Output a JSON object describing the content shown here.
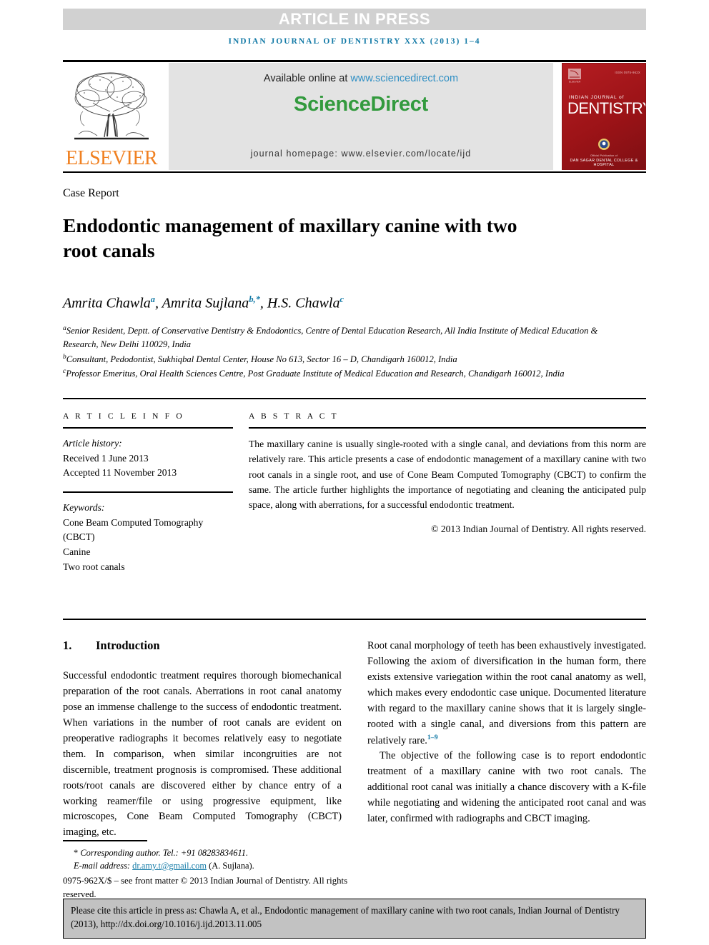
{
  "banner": {
    "article_in_press": "ARTICLE IN PRESS",
    "running_head": "INDIAN JOURNAL OF DENTISTRY XXX (2013) 1–4"
  },
  "masthead": {
    "elsevier_wordmark": "ELSEVIER",
    "available_online_prefix": "Available online at ",
    "sciencedirect_url": "www.sciencedirect.com",
    "sciencedirect_logo": "ScienceDirect",
    "journal_homepage": "journal homepage: www.elsevier.com/locate/ijd",
    "cover": {
      "issn": "ISSN 0975-962X",
      "indian_journal_of": "INDIAN JOURNAL of",
      "dentistry": "DENTISTRY",
      "footline1": "Official Publication of",
      "footline2": "DAN SAGAR DENTAL COLLEGE & HOSPITAL"
    },
    "colors": {
      "banner_gray": "#d1d1d1",
      "running_head_blue": "#1279a6",
      "elsevier_orange": "#f08122",
      "sciencedirect_green": "#339a3e",
      "sd_panel_gray": "#e3e3e3",
      "link_blue": "#2f8fc4",
      "cover_red": "#a4161a"
    }
  },
  "article": {
    "kicker": "Case Report",
    "title": "Endodontic management of maxillary canine with two root canals",
    "authors": [
      {
        "name": "Amrita Chawla",
        "marks": "a"
      },
      {
        "name": "Amrita Sujlana",
        "marks": "b,*"
      },
      {
        "name": "H.S. Chawla",
        "marks": "c"
      }
    ],
    "affiliations": [
      {
        "mark": "a",
        "text": "Senior Resident, Deptt. of Conservative Dentistry & Endodontics, Centre of Dental Education Research, All India Institute of Medical Education & Research, New Delhi 110029, India"
      },
      {
        "mark": "b",
        "text": "Consultant, Pedodontist, Sukhiqbal Dental Center, House No 613, Sector 16 – D, Chandigarh 160012, India"
      },
      {
        "mark": "c",
        "text": "Professor Emeritus, Oral Health Sciences Centre, Post Graduate Institute of Medical Education and Research, Chandigarh 160012, India"
      }
    ]
  },
  "article_info": {
    "heading": "A R T I C L E   I N F O",
    "history_label": "Article history:",
    "received": "Received 1 June 2013",
    "accepted": "Accepted 11 November 2013",
    "keywords_label": "Keywords:",
    "keywords": [
      "Cone Beam Computed Tomography",
      "(CBCT)",
      "Canine",
      "Two root canals"
    ]
  },
  "abstract": {
    "heading": "A B S T R A C T",
    "text": "The maxillary canine is usually single-rooted with a single canal, and deviations from this norm are relatively rare. This article presents a case of endodontic management of a maxillary canine with two root canals in a single root, and use of Cone Beam Computed Tomography (CBCT) to confirm the same. The article further highlights the importance of negotiating and cleaning the anticipated pulp space, along with aberrations, for a successful endodontic treatment.",
    "copyright": "© 2013 Indian Journal of Dentistry. All rights reserved."
  },
  "body": {
    "section_number": "1.",
    "section_title": "Introduction",
    "left_paragraph": "Successful endodontic treatment requires thorough biomechanical preparation of the root canals. Aberrations in root canal anatomy pose an immense challenge to the success of endodontic treatment. When variations in the number of root canals are evident on preoperative radiographs it becomes relatively easy to negotiate them. In comparison, when similar incongruities are not discernible, treatment prognosis is compromised. These additional roots/root canals are discovered either by chance entry of a working reamer/file or using progressive equipment, like microscopes, Cone Beam Computed Tomography (CBCT) imaging, etc.",
    "right_paragraph_1": "Root canal morphology of teeth has been exhaustively investigated. Following the axiom of diversification in the human form, there exists extensive variegation within the root canal anatomy as well, which makes every endodontic case unique. Documented literature with regard to the maxillary canine shows that it is largely single-rooted with a single canal, and diversions from this pattern are relatively rare.",
    "right_paragraph_1_ref": "1–9",
    "right_paragraph_2": "The objective of the following case is to report endodontic treatment of a maxillary canine with two root canals. The additional root canal was initially a chance discovery with a K-file while negotiating and widening the anticipated root canal and was later, confirmed with radiographs and CBCT imaging."
  },
  "footnotes": {
    "corresponding_star": "*",
    "corresponding_author": "Corresponding author. Tel.: +91 08283834611.",
    "email_label": "E-mail address: ",
    "email_address": "dr.amy.t@gmail.com",
    "email_suffix": " (A. Sujlana).",
    "front_matter": "0975-962X/$ – see front matter © 2013 Indian Journal of Dentistry. All rights reserved.",
    "doi": "http://dx.doi.org/10.1016/j.ijd.2013.11.005"
  },
  "citation_box": {
    "text": "Please cite this article in press as: Chawla A, et al., Endodontic management of maxillary canine with two root canals, Indian Journal of Dentistry (2013), http://dx.doi.org/10.1016/j.ijd.2013.11.005"
  }
}
